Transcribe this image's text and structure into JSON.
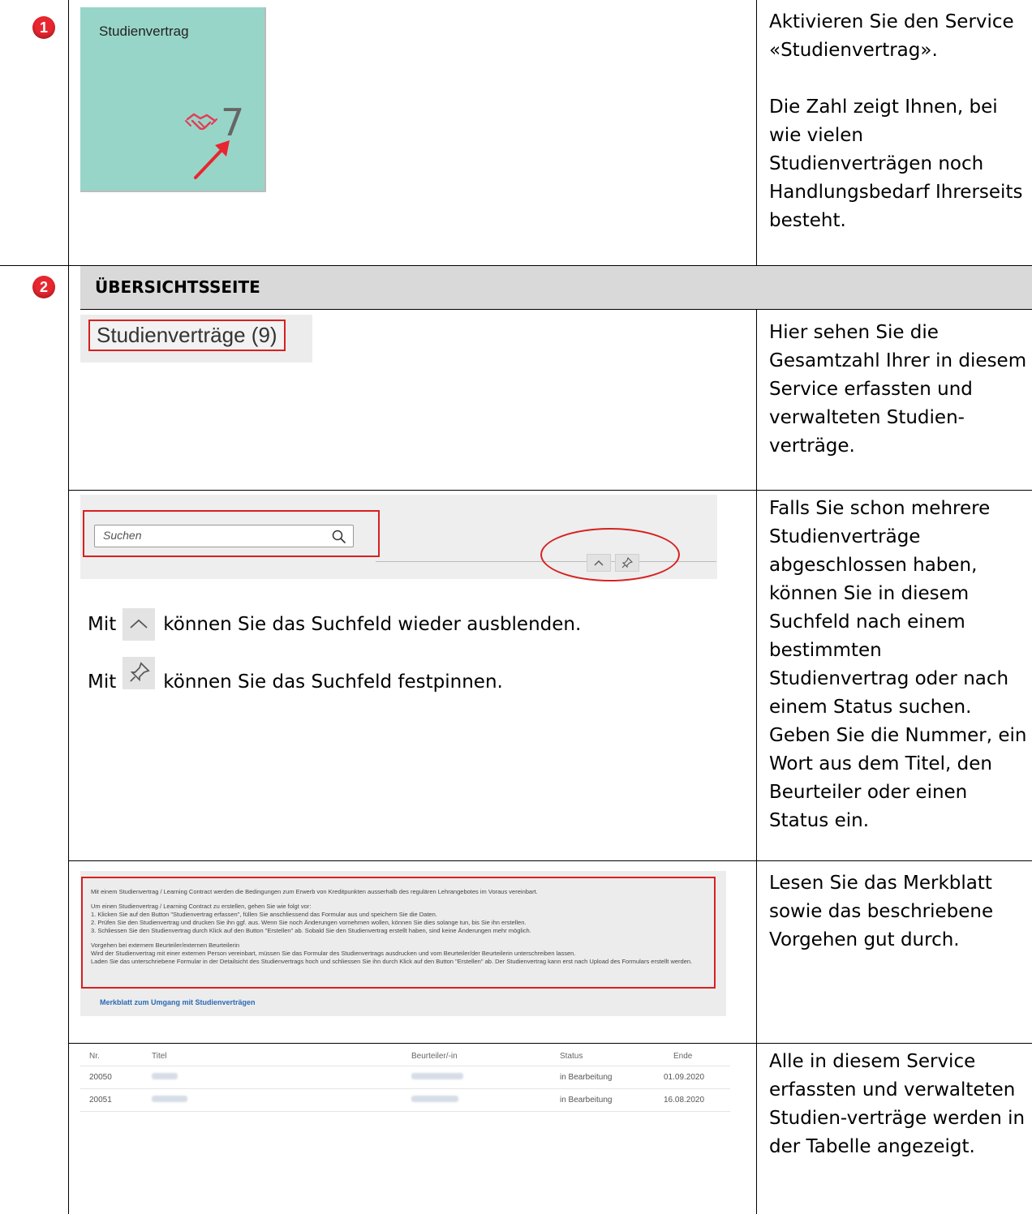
{
  "steps": [
    {
      "badge": "1"
    },
    {
      "badge": "2"
    }
  ],
  "row1": {
    "tile": {
      "title": "Studienvertrag",
      "count": "7",
      "icon": "handshake-icon"
    },
    "description": [
      "Aktivieren Sie den Service «Studienvertrag».",
      "Die Zahl zeigt Ihnen, bei wie vielen Studienverträgen noch Handlungsbedarf Ihrerseits besteht."
    ]
  },
  "section": {
    "heading": "ÜBERSICHTSSEITE"
  },
  "row2": {
    "count_label": "Studienverträge (9)",
    "description": "Hier sehen Sie die Gesamtzahl Ihrer in diesem Service erfassten und verwalteten Studien-verträge."
  },
  "row3": {
    "search_placeholder": "Suchen",
    "collapse_text_before": "Mit",
    "collapse_text_after": "können Sie das Suchfeld wieder ausblenden.",
    "pin_text_before": "Mit",
    "pin_text_after": "können Sie das Suchfeld festpinnen.",
    "description": "Falls Sie schon mehrere Studienverträge abgeschlossen haben, können Sie in diesem Suchfeld nach einem bestimmten Studienvertrag oder nach einem Status suchen. Geben Sie die Nummer, ein Wort aus dem Titel, den Beurteiler oder einen Status ein."
  },
  "row4": {
    "merkblatt_paragraphs": [
      "Mit einem Studienvertrag / Learning Contract werden die Bedingungen zum Erwerb von Kreditpunkten ausserhalb des regulären Lehrangebotes im Voraus vereinbart.",
      "Um einen Studienvertrag / Learning Contract zu erstellen, gehen Sie wie folgt vor:\n1. Klicken Sie auf den Button \"Studienvertrag erfassen\", füllen Sie anschliessend das Formular aus und speichern Sie die Daten.\n2. Prüfen Sie den Studienvertrag und drucken Sie ihn ggf. aus. Wenn Sie noch Änderungen vornehmen wollen, können Sie dies solange tun, bis Sie ihn erstellen.\n3. Schliessen Sie den Studienvertrag durch Klick auf den Button \"Erstellen\" ab. Sobald Sie den Studienvertrag erstellt haben, sind keine Änderungen mehr möglich.",
      "Vorgehen bei externem Beurteiler/externen Beurteilerin\nWird der Studienvertrag mit einer externen Person vereinbart, müssen Sie das Formular des Studienvertrags ausdrucken und vom Beurteiler/der Beurteilerin unterschreiben lassen.\nLaden Sie das unterschriebene Formular in der Detailsicht des Studienvertrags hoch und schliessen Sie ihn durch Klick auf den Button \"Erstellen\" ab. Der Studienvertrag kann erst nach Upload des Formulars erstellt werden."
    ],
    "link": "Merkblatt zum Umgang mit Studienverträgen",
    "description": "Lesen Sie das Merkblatt sowie das beschriebene Vorgehen gut durch."
  },
  "row5": {
    "table": {
      "headers": [
        "Nr.",
        "Titel",
        "Beurteiler/-in",
        "Status",
        "Ende"
      ],
      "rows": [
        [
          "20050",
          "",
          "",
          "in Bearbeitung",
          "01.09.2020"
        ],
        [
          "20051",
          "",
          "",
          "in Bearbeitung",
          "16.08.2020"
        ]
      ]
    },
    "description": "Alle in diesem Service erfassten und verwalteten Studien-verträge werden in der Tabelle angezeigt."
  },
  "colors": {
    "accent_red": "#d82020",
    "badge_red": "#e8262f",
    "tile_teal": "#98d5c9",
    "link_blue": "#2a6ab5"
  }
}
